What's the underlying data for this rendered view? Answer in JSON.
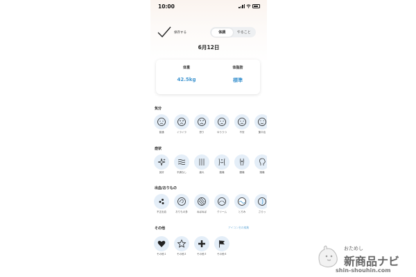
{
  "status_bar": {
    "time": "10:00"
  },
  "header": {
    "save_label": "保存する",
    "tabs": [
      "体調",
      "やること"
    ],
    "active_tab": 0,
    "date": "6月12日"
  },
  "summary": {
    "weight_label": "体重",
    "weight_value": "42.5kg",
    "bodyfat_label": "体脂肪",
    "bodyfat_value": "標準"
  },
  "mood": {
    "title": "気分",
    "items": [
      {
        "icon": "neutral-face-icon",
        "label": "普通"
      },
      {
        "icon": "irritated-face-icon",
        "label": "イライラ"
      },
      {
        "icon": "angry-face-icon",
        "label": "怒り"
      },
      {
        "icon": "gloomy-face-icon",
        "label": "ゆううつ"
      },
      {
        "icon": "uneasy-face-icon",
        "label": "不安"
      },
      {
        "icon": "happy-face-icon",
        "label": "集中出"
      }
    ]
  },
  "symptoms": {
    "title": "症状",
    "items": [
      {
        "icon": "sparkle-icon",
        "label": "良好"
      },
      {
        "icon": "waves-icon",
        "label": "不調なし"
      },
      {
        "icon": "lines-icon",
        "label": "疲れ"
      },
      {
        "icon": "abdomen-icon",
        "label": "腹痛"
      },
      {
        "icon": "body-icon",
        "label": "腰痛"
      },
      {
        "icon": "head-icon",
        "label": "頭痛"
      }
    ]
  },
  "discharge": {
    "title": "出血/おりもの",
    "items": [
      {
        "icon": "dots-icon",
        "label": "不正出血"
      },
      {
        "icon": "swirl-icon",
        "label": "おりもの多"
      },
      {
        "icon": "striped-circle-icon",
        "label": "ねばねば"
      },
      {
        "icon": "curve-icon",
        "label": "クリーム"
      },
      {
        "icon": "wave-circle-icon",
        "label": "とろみ"
      },
      {
        "icon": "drop-circle-icon",
        "label": "さらっ"
      }
    ]
  },
  "other": {
    "title": "その他",
    "edit_link": "アイコン名の編集",
    "items": [
      {
        "icon": "heart-icon",
        "label": "その他１"
      },
      {
        "icon": "star-icon",
        "label": "その他２"
      },
      {
        "icon": "plus-icon",
        "label": "その他３"
      },
      {
        "icon": "flag-icon",
        "label": "その他４"
      }
    ]
  },
  "watermark": {
    "small": "おためし",
    "big": "新商品ナビ",
    "url": "shin-shouhin.com"
  },
  "colors": {
    "accent": "#3c93cf",
    "icon_bg": "#e4eef8",
    "link": "#7cb6dd"
  }
}
